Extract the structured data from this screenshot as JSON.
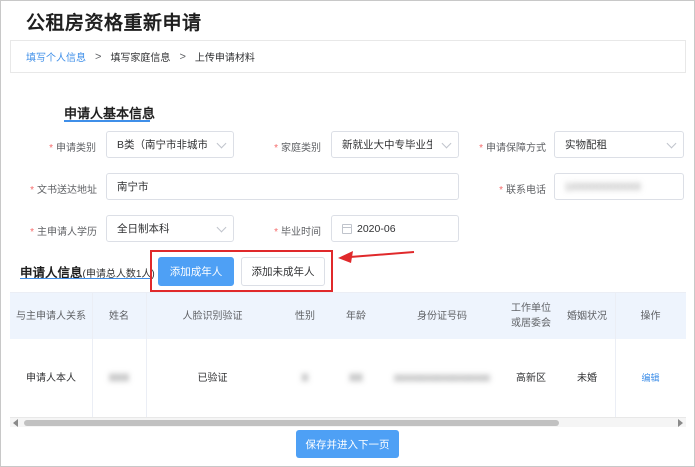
{
  "page_title": "公租房资格重新申请",
  "breadcrumb": {
    "steps": [
      "填写个人信息",
      "填写家庭信息",
      "上传申请材料"
    ],
    "separator": ">"
  },
  "basic_info": {
    "title": "申请人基本信息",
    "fields": {
      "apply_category": {
        "label": "申请类别",
        "value": "B类（南宁市非城市低收"
      },
      "family_category": {
        "label": "家庭类别",
        "value": "新就业大中专毕业生"
      },
      "guarantee_method": {
        "label": "申请保障方式",
        "value": "实物配租"
      },
      "delivery_address": {
        "label": "文书送达地址",
        "value": "南宁市"
      },
      "contact_phone": {
        "label": "联系电话",
        "value": "1XXXXXXXXXX"
      },
      "education": {
        "label": "主申请人学历",
        "value": "全日制本科"
      },
      "graduation_time": {
        "label": "毕业时间",
        "value": "2020-06"
      }
    }
  },
  "applicant_info": {
    "title": "申请人信息",
    "subtitle": "(申请总人数1人)",
    "add_adult_label": "添加成年人",
    "add_minor_label": "添加未成年人"
  },
  "table": {
    "headers": [
      "与主申请人关系",
      "姓名",
      "人脸识别验证",
      "性别",
      "年龄",
      "身份证号码",
      "工作单位或居委会",
      "婚姻状况",
      "操作"
    ],
    "rows": [
      {
        "relation": "申请人本人",
        "name": "XXX",
        "face": "已验证",
        "gender": "X",
        "age": "XX",
        "id_number": "XXXXXXXXXXXXXXXXXX",
        "work_unit": "高新区",
        "marital": "未婚",
        "action": "编辑"
      }
    ]
  },
  "footer": {
    "next_label": "保存并进入下一页"
  },
  "colors": {
    "primary": "#4ea0f5",
    "link": "#3f8fe9",
    "highlight": "#e0292b",
    "required": "#f56c6c"
  }
}
